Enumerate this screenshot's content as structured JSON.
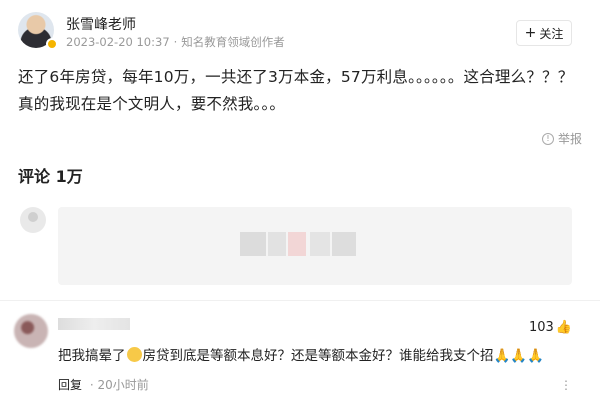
{
  "author": {
    "name": "张雪峰老师",
    "date": "2023-02-20 10:37",
    "separator": "·",
    "title": "知名教育领域创作者"
  },
  "follow": {
    "plus": "+",
    "label": "关注"
  },
  "post": {
    "line1": "还了6年房贷，每年10万，一共还了3万本金，57万利息。。。。。。这合理么？？？",
    "line2": "真的我现在是个文明人，要不然我。。。"
  },
  "report": {
    "icon": "warning-icon",
    "label": "举报"
  },
  "comments": {
    "title": "评论 1万"
  },
  "comment": {
    "likes": "103",
    "like_icon": "thumbs-up-icon",
    "text_before": "把我搞晕了",
    "text_after": "房贷到底是等额本息好？还是等额本金好？谁能给我支个招",
    "hands": "🙏🙏🙏",
    "reply_label": "回复",
    "separator": "·",
    "time": "20小时前"
  }
}
